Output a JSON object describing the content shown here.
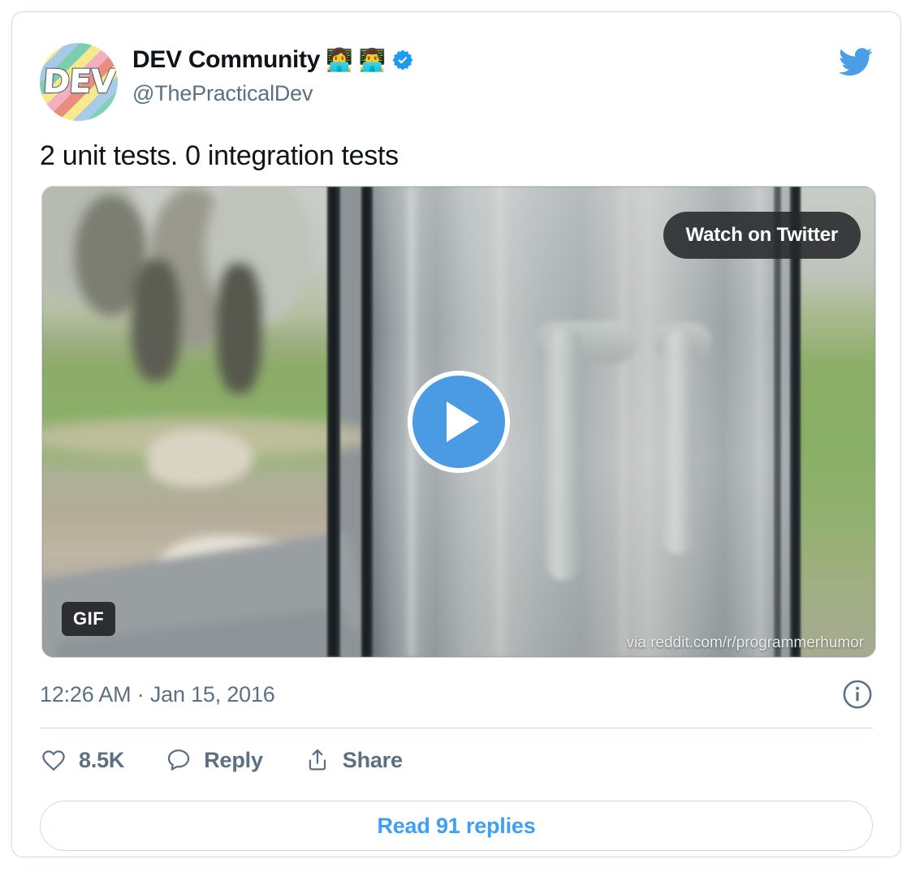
{
  "card": {
    "author": {
      "display_name": "DEV Community",
      "handle": "@ThePracticalDev",
      "avatar_text": "DEV",
      "emoji_woman_technologist": "👩‍💻",
      "emoji_man_technologist": "👨‍💻",
      "verified": true
    },
    "platform_icon": "twitter-bird-icon",
    "text": "2 unit tests. 0 integration tests",
    "media": {
      "watch_label": "Watch on Twitter",
      "gif_badge": "GIF",
      "attribution": "via reddit.com/r/programmerhumor",
      "play_icon": "play-icon"
    },
    "timestamp": "12:26 AM · Jan 15, 2016",
    "info_icon": "info-circle-icon",
    "actions": [
      {
        "icon": "heart-icon",
        "label": "8.5K"
      },
      {
        "icon": "comment-icon",
        "label": "Reply"
      },
      {
        "icon": "share-icon",
        "label": "Share"
      }
    ],
    "replies_button": "Read 91 replies"
  },
  "colors": {
    "accent_blue": "#3ea0f5",
    "play_blue": "#4a9ae4",
    "text_primary": "#0f1419",
    "text_secondary": "#5b7083",
    "border": "#cfd9de",
    "verified_blue": "#1d9bf0"
  }
}
